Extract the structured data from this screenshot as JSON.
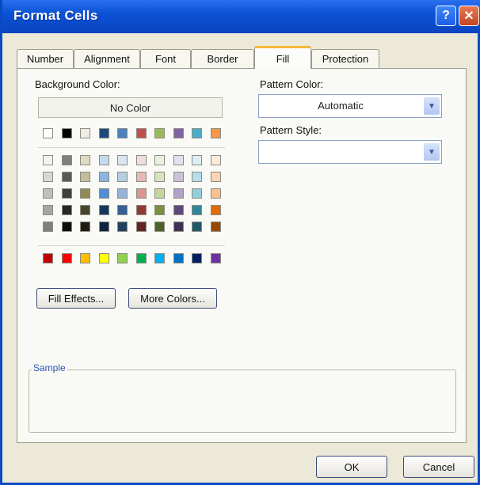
{
  "dialog": {
    "title": "Format Cells",
    "help_label": "?",
    "close_label": "✕"
  },
  "tabs": [
    {
      "label": "Number",
      "active": false
    },
    {
      "label": "Alignment",
      "active": false
    },
    {
      "label": "Font",
      "active": false
    },
    {
      "label": "Border",
      "active": false
    },
    {
      "label": "Fill",
      "active": true
    },
    {
      "label": "Protection",
      "active": false
    }
  ],
  "fill": {
    "background_color_label": "Background Color:",
    "no_color_label": "No Color",
    "pattern_color_label": "Pattern Color:",
    "pattern_color_value": "Automatic",
    "pattern_style_label": "Pattern Style:",
    "pattern_style_value": "",
    "fill_effects_label": "Fill Effects...",
    "more_colors_label": "More Colors...",
    "sample_label": "Sample"
  },
  "palette": {
    "theme_row": [
      "#ffffff",
      "#000000",
      "#eeece1",
      "#1f497d",
      "#4f81bd",
      "#c0504d",
      "#9bbb59",
      "#8064a2",
      "#4bacc6",
      "#f79646"
    ],
    "tint_rows": [
      [
        "#f2f2f2",
        "#7f7f7f",
        "#ddd9c3",
        "#c6d9f0",
        "#dbe5f1",
        "#f2dcdb",
        "#ebf1dd",
        "#e5e0ec",
        "#dbeef3",
        "#fdeada"
      ],
      [
        "#d8d8d8",
        "#595959",
        "#c4bd97",
        "#8db3e2",
        "#b8cce4",
        "#e5b9b7",
        "#d7e3bc",
        "#ccc1d9",
        "#b7dde8",
        "#fbd5b5"
      ],
      [
        "#bfbfbf",
        "#3f3f3f",
        "#938953",
        "#548dd4",
        "#95b3d7",
        "#d99694",
        "#c3d69b",
        "#b2a2c7",
        "#92cddc",
        "#fac08f"
      ],
      [
        "#a5a5a5",
        "#262626",
        "#494429",
        "#17365d",
        "#366092",
        "#953734",
        "#76923c",
        "#5f497a",
        "#31859b",
        "#e36c09"
      ],
      [
        "#7f7f7f",
        "#0c0c0c",
        "#1d1b10",
        "#0f243e",
        "#244061",
        "#632423",
        "#4f6128",
        "#3f3151",
        "#205867",
        "#974806"
      ]
    ],
    "standard_row": [
      "#c00000",
      "#ff0000",
      "#ffc000",
      "#ffff00",
      "#92d050",
      "#00b050",
      "#00b0f0",
      "#0070c0",
      "#002060",
      "#7030a0"
    ]
  },
  "footer": {
    "ok_label": "OK",
    "cancel_label": "Cancel"
  }
}
